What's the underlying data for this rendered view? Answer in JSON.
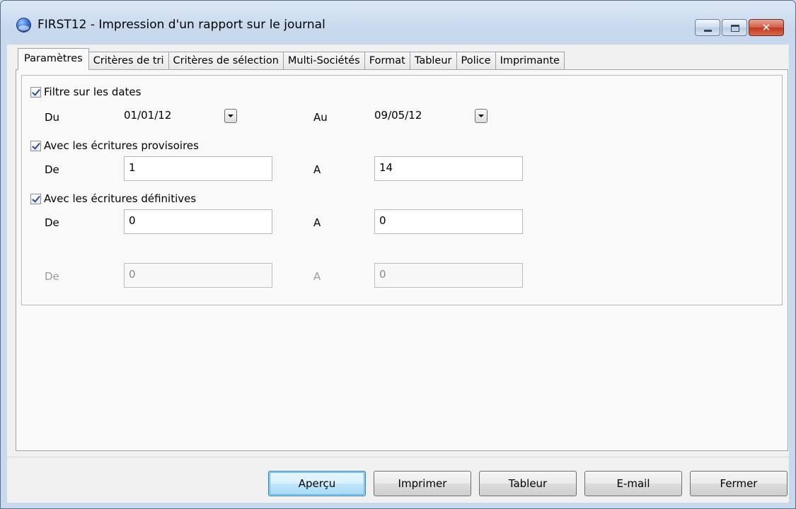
{
  "window": {
    "title": "FIRST12 - Impression d'un rapport sur le journal",
    "caption_buttons": {
      "minimize": "minimize",
      "maximize": "maximize",
      "close": "✕"
    }
  },
  "tabs": [
    {
      "label": "Paramètres",
      "active": true
    },
    {
      "label": "Critères de tri"
    },
    {
      "label": "Critères de sélection"
    },
    {
      "label": "Multi-Sociétés"
    },
    {
      "label": "Format"
    },
    {
      "label": "Tableur"
    },
    {
      "label": "Police"
    },
    {
      "label": "Imprimante"
    }
  ],
  "params": {
    "dates": {
      "label": "Filtre sur les dates",
      "checked": true,
      "from_label": "Du",
      "from_value": "01/01/12",
      "to_label": "Au",
      "to_value": "09/05/12"
    },
    "provisional": {
      "label": "Avec les écritures provisoires",
      "checked": true,
      "from_label": "De",
      "from_value": "1",
      "to_label": "A",
      "to_value": "14"
    },
    "definitive": {
      "label": "Avec les écritures définitives",
      "checked": true,
      "from_label": "De",
      "from_value": "0",
      "to_label": "A",
      "to_value": "0"
    },
    "disabled_range": {
      "from_label": "De",
      "from_value": "0",
      "to_label": "A",
      "to_value": "0"
    }
  },
  "buttons": {
    "preview": "Aperçu",
    "print": "Imprimer",
    "spreadsheet": "Tableur",
    "email": "E-mail",
    "close": "Fermer"
  }
}
